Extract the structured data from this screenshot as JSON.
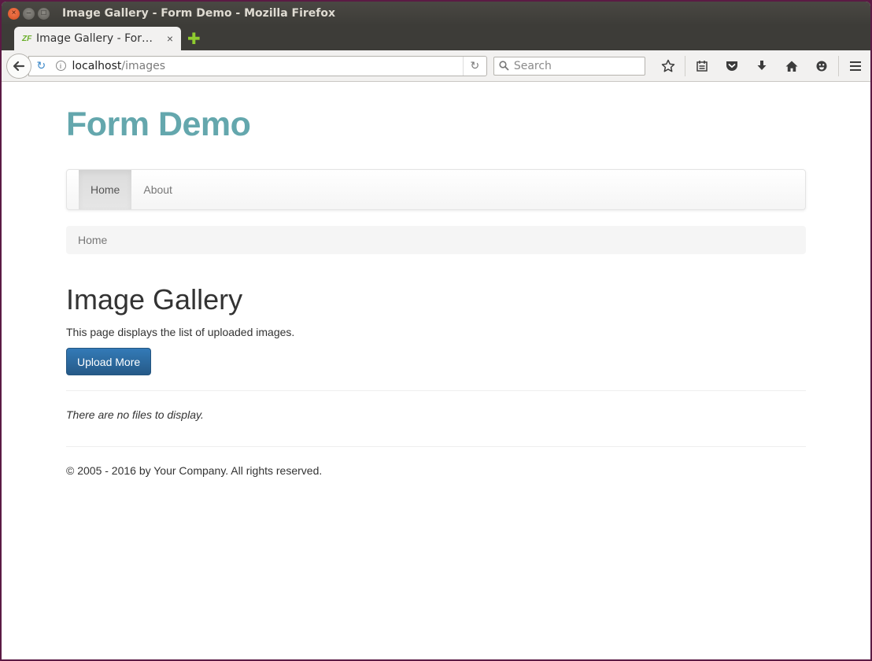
{
  "window": {
    "title": "Image Gallery - Form Demo - Mozilla Firefox",
    "controls": {
      "close": "×",
      "minimize": "–",
      "maximize": "□"
    }
  },
  "tab": {
    "favicon_text": "ZF",
    "label": "Image Gallery - For…",
    "close": "×",
    "new_tab": "✚"
  },
  "browser_nav": {
    "back": "🡐",
    "forward": "↻",
    "info": "i",
    "url_host": "localhost",
    "url_path": "/images",
    "reload": "↻",
    "search_placeholder": "Search",
    "icons": [
      "bookmark-star-icon",
      "reader-list-icon",
      "pocket-icon",
      "download-icon",
      "home-icon",
      "emoji-icon",
      "menu-icon"
    ]
  },
  "site": {
    "brand": "Form Demo",
    "nav": [
      {
        "label": "Home",
        "active": true
      },
      {
        "label": "About",
        "active": false
      }
    ],
    "breadcrumb": "Home"
  },
  "main": {
    "title": "Image Gallery",
    "description": "This page displays the list of uploaded images.",
    "upload_button": "Upload More",
    "empty_message": "There are no files to display."
  },
  "footer": {
    "text": "© 2005 - 2016 by Your Company. All rights reserved."
  },
  "colors": {
    "brand": "#64a7ad",
    "primary_button": "#337ab7",
    "titlebar": "#3d3c38",
    "desktop_frame": "#5b1a44"
  }
}
